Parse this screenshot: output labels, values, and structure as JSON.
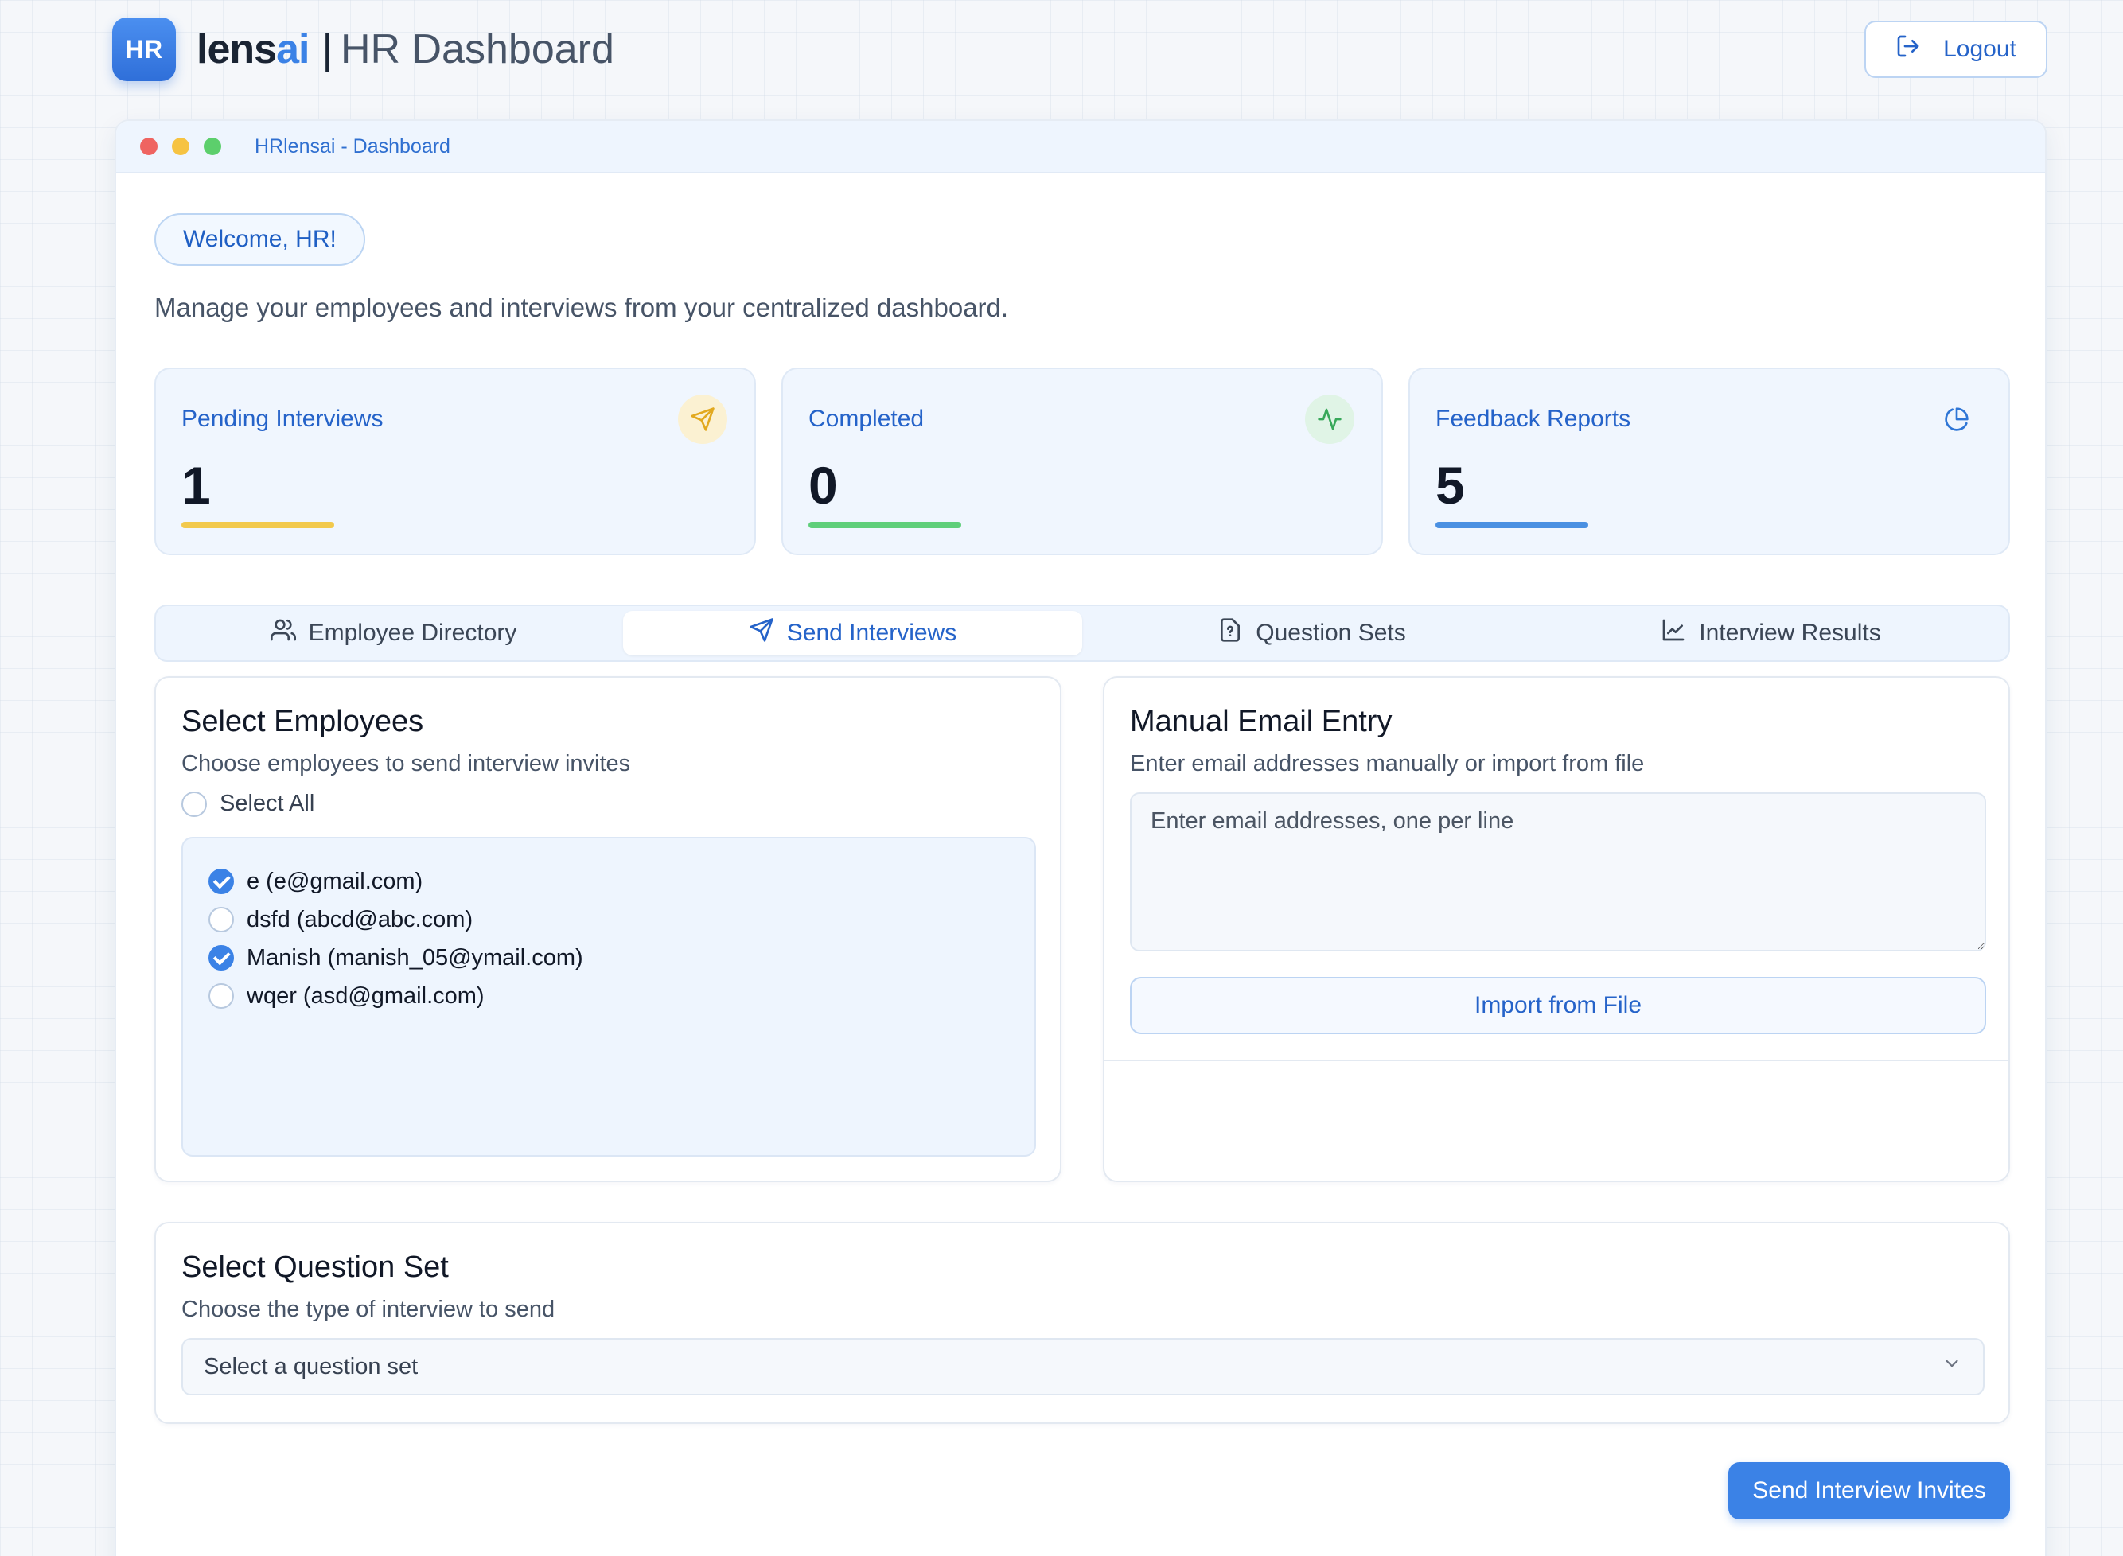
{
  "header": {
    "logo_text": "HR",
    "brand_prefix": "lens",
    "brand_suffix": "ai",
    "separator": "|",
    "title": "HR Dashboard",
    "logout_label": "Logout"
  },
  "window": {
    "title": "HRlensai - Dashboard"
  },
  "welcome": {
    "badge": "Welcome, HR!",
    "intro": "Manage your employees and interviews from your centralized dashboard."
  },
  "stats": [
    {
      "label": "Pending Interviews",
      "value": "1",
      "icon": "send-icon",
      "color": "#f2c94c"
    },
    {
      "label": "Completed",
      "value": "0",
      "icon": "activity-icon",
      "color": "#5fcf7a"
    },
    {
      "label": "Feedback Reports",
      "value": "5",
      "icon": "pie-chart-icon",
      "color": "#4a90e2"
    }
  ],
  "tabs": [
    {
      "label": "Employee Directory",
      "icon": "users-icon",
      "active": false
    },
    {
      "label": "Send Interviews",
      "icon": "send-icon",
      "active": true
    },
    {
      "label": "Question Sets",
      "icon": "file-question-icon",
      "active": false
    },
    {
      "label": "Interview Results",
      "icon": "line-chart-icon",
      "active": false
    }
  ],
  "select_employees": {
    "title": "Select Employees",
    "subtitle": "Choose employees to send interview invites",
    "select_all": "Select All",
    "employees": [
      {
        "label": "e (e@gmail.com)",
        "checked": true
      },
      {
        "label": "dsfd (abcd@abc.com)",
        "checked": false
      },
      {
        "label": "Manish (manish_05@ymail.com)",
        "checked": true
      },
      {
        "label": "wqer (asd@gmail.com)",
        "checked": false
      }
    ]
  },
  "manual_email": {
    "title": "Manual Email Entry",
    "subtitle": "Enter email addresses manually or import from file",
    "placeholder": "Enter email addresses, one per line",
    "import_label": "Import from File"
  },
  "question_set": {
    "title": "Select Question Set",
    "subtitle": "Choose the type of interview to send",
    "placeholder": "Select a question set"
  },
  "send_label": "Send Interview Invites",
  "colors": {
    "accent": "#3b82e6",
    "pending": "#f2c94c",
    "completed": "#5fcf7a",
    "feedback": "#4a90e2"
  }
}
